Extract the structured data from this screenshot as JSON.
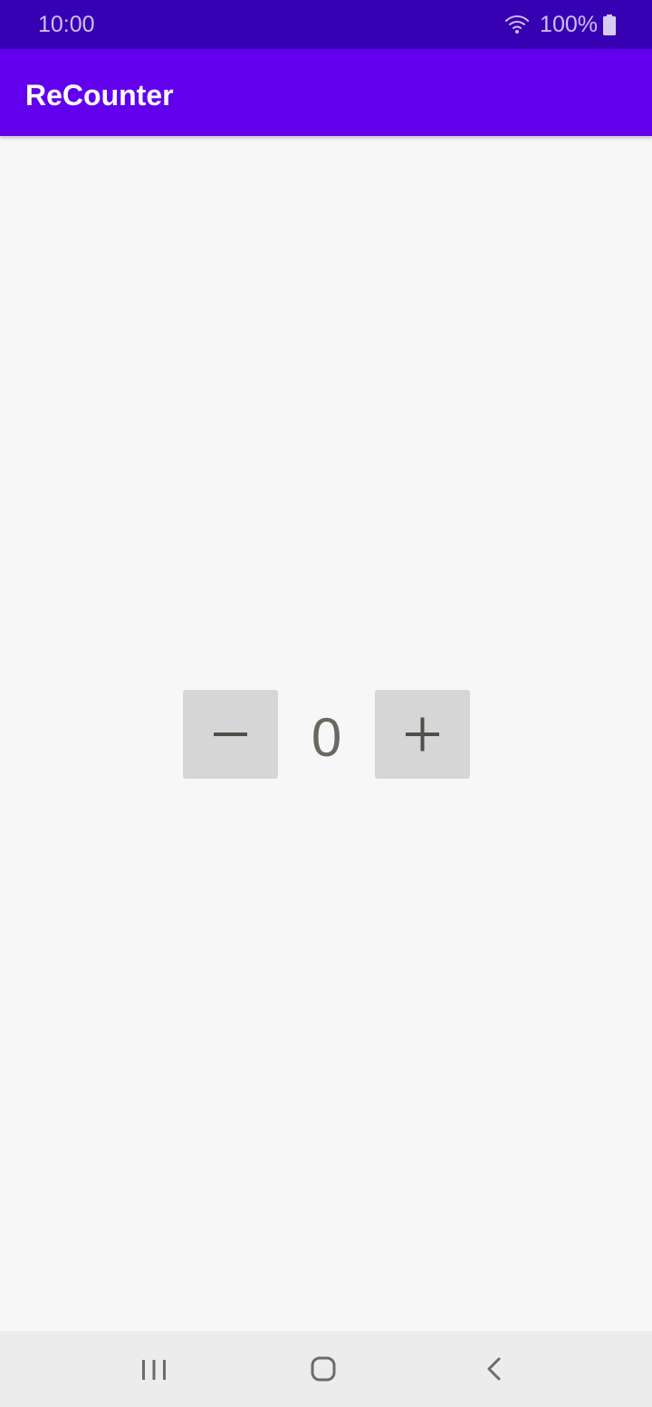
{
  "status_bar": {
    "time": "10:00",
    "battery": "100%",
    "wifi_icon": "wifi-icon",
    "battery_icon": "battery-icon"
  },
  "app_bar": {
    "title": "ReCounter",
    "color": "#6200ee",
    "status_color": "#3700b3"
  },
  "counter": {
    "value": "0",
    "decrement_icon": "minus-icon",
    "increment_icon": "plus-icon"
  },
  "nav_bar": {
    "recents_icon": "recents-icon",
    "home_icon": "home-icon",
    "back_icon": "back-icon"
  }
}
